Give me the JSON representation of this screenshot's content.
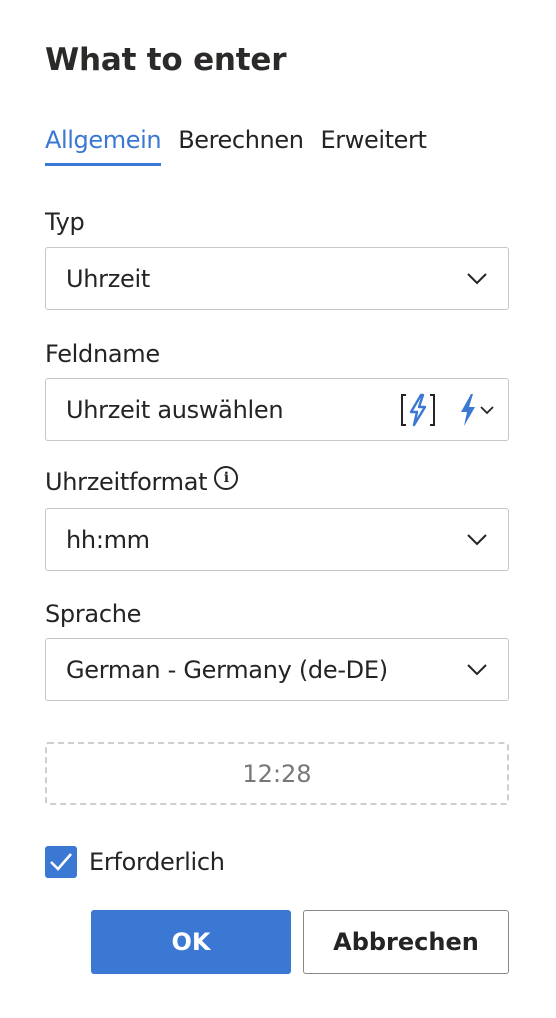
{
  "dialog": {
    "title": "What to enter"
  },
  "tabs": [
    {
      "label": "Allgemein",
      "active": true
    },
    {
      "label": "Berechnen",
      "active": false
    },
    {
      "label": "Erweitert",
      "active": false
    }
  ],
  "fields": {
    "type": {
      "label": "Typ",
      "value": "Uhrzeit"
    },
    "fieldname": {
      "label": "Feldname",
      "value": "Uhrzeit auswählen"
    },
    "time_format": {
      "label": "Uhrzeitformat",
      "value": "hh:mm",
      "info_icon": "info-icon"
    },
    "language": {
      "label": "Sprache",
      "value": "German - Germany (de-DE)"
    }
  },
  "preview": {
    "value": "12:28"
  },
  "required": {
    "label": "Erforderlich",
    "checked": true
  },
  "buttons": {
    "ok": "OK",
    "cancel": "Abbrechen"
  },
  "colors": {
    "accent": "#3a78d4",
    "border": "#c8c6c4",
    "text": "#252423"
  }
}
